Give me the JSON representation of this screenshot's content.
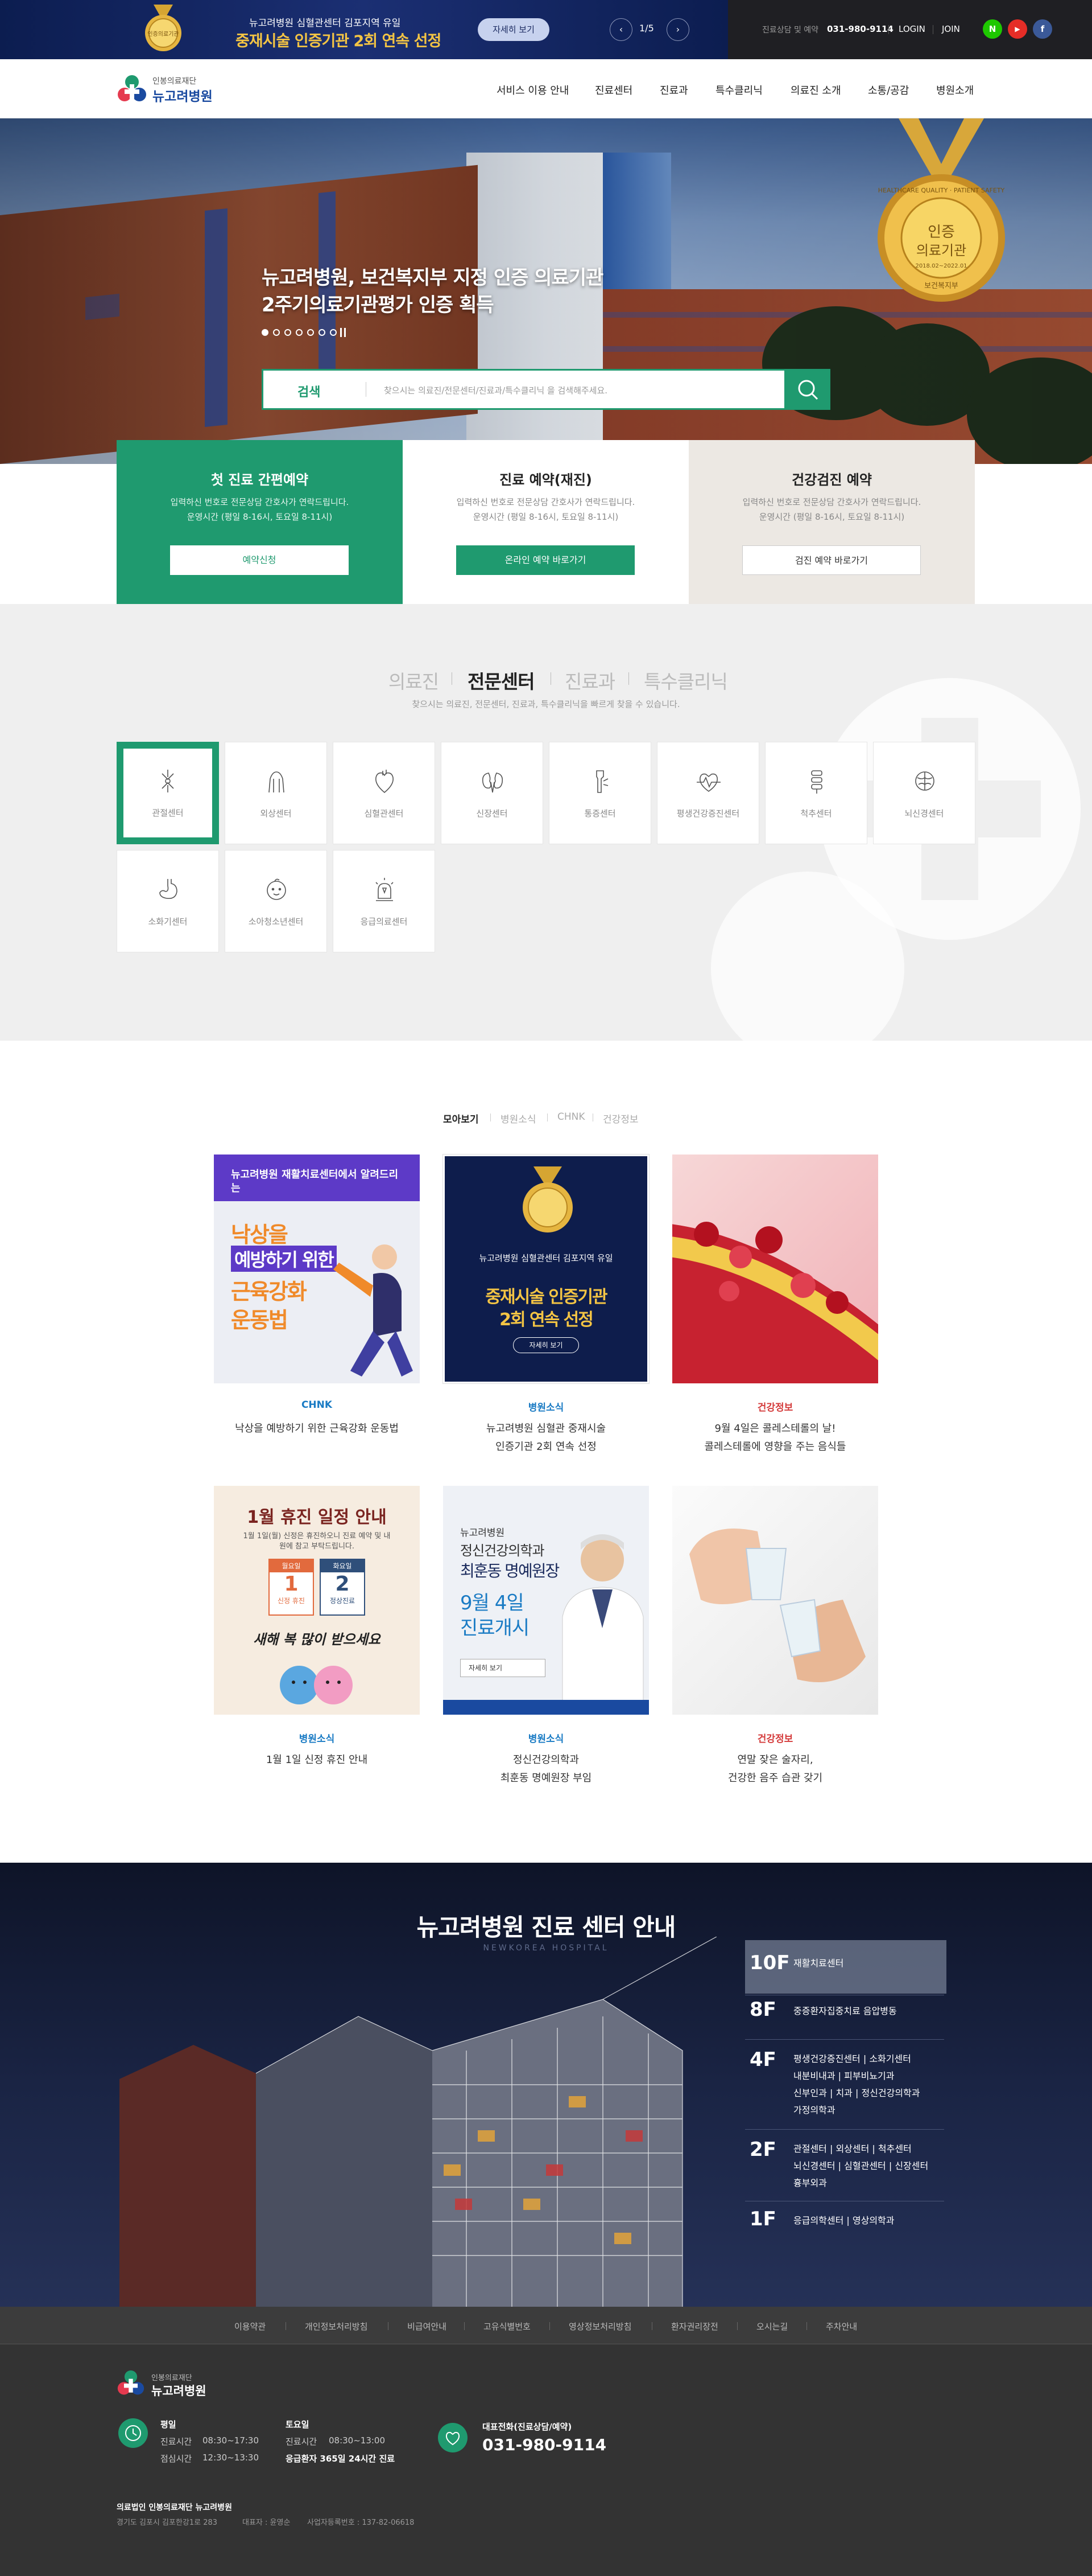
{
  "topbar": {
    "medal_text": "인증의료기관",
    "line1": "뉴고려병원 심혈관센터 김포지역 유일",
    "line2": "중재시술 인증기관 2회 연속 선정",
    "more": "자세히 보기",
    "prev": "‹",
    "next": "›",
    "page": "1/5",
    "phone_label": "진료상담 및 예약",
    "phone": "031-980-9114",
    "login": "LOGIN",
    "join": "JOIN",
    "sns": [
      {
        "name": "naver-icon",
        "label": "N",
        "color": "#1ec800"
      },
      {
        "name": "youtube-icon",
        "label": "▶",
        "color": "#e52d27"
      },
      {
        "name": "facebook-icon",
        "label": "f",
        "color": "#3b5998"
      }
    ]
  },
  "header": {
    "logo_sub": "인봉의료재단",
    "logo_main": "뉴고려병원",
    "nav": [
      "서비스 이용 안내",
      "진료센터",
      "진료과",
      "특수클리닉",
      "의료진 소개",
      "소통/공감",
      "병원소개"
    ]
  },
  "hero": {
    "title1": "뉴고려병원, 보건복지부 지정 인증 의료기관",
    "title2": "2주기의료기관평가 인증 획득",
    "badge_main": "인증",
    "badge_sub": "의료기관",
    "badge_ring": "HEALTHCARE QUALITY · PATIENT SAFETY",
    "badge_date": "2018.02~2022.01",
    "badge_org": "보건복지부",
    "search_label": "검색",
    "search_placeholder": "찾으시는 의료진/전문센터/진료과/특수클리닉 을 검색해주세요."
  },
  "reservations": [
    {
      "title": "첫 진료 간편예약",
      "desc1": "입력하신 번호로 전문상담 간호사가 연락드립니다.",
      "desc2": "운영시간 (평일 8-16시, 토요일 8-11시)",
      "button": "예약신청"
    },
    {
      "title": "진료 예약(재진)",
      "desc1": "입력하신 번호로 전문상담 간호사가 연락드립니다.",
      "desc2": "운영시간 (평일 8-16시, 토요일 8-11시)",
      "button": "온라인 예약 바로가기"
    },
    {
      "title": "건강검진 예약",
      "desc1": "입력하신 번호로 전문상담 간호사가 연락드립니다.",
      "desc2": "운영시간 (평일 8-16시, 토요일 8-11시)",
      "button": "검진 예약 바로가기"
    }
  ],
  "centers": {
    "tabs": [
      "의료진",
      "전문센터",
      "진료과",
      "특수클리닉"
    ],
    "subtitle": "찾으시는 의료진, 전문센터, 진료과, 특수클리닉을 빠르게 찾을 수 있습니다.",
    "items": [
      {
        "label": "관절센터",
        "icon": "joint-icon"
      },
      {
        "label": "외상센터",
        "icon": "trauma-icon"
      },
      {
        "label": "심혈관센터",
        "icon": "heart-icon"
      },
      {
        "label": "신장센터",
        "icon": "kidney-icon"
      },
      {
        "label": "통증센터",
        "icon": "pain-icon"
      },
      {
        "label": "평생건강증진센터",
        "icon": "heartbeat-icon"
      },
      {
        "label": "척추센터",
        "icon": "spine-icon"
      },
      {
        "label": "뇌신경센터",
        "icon": "brain-icon"
      },
      {
        "label": "소화기센터",
        "icon": "stomach-icon"
      },
      {
        "label": "소아청소년센터",
        "icon": "baby-icon"
      },
      {
        "label": "응급의료센터",
        "icon": "siren-icon"
      }
    ]
  },
  "news": {
    "tabs": [
      "모아보기",
      "병원소식",
      "CHNK",
      "건강정보"
    ],
    "cards": [
      {
        "category": "CHNK",
        "title1": "낙상을 예방하기 위한 근육강화 운동법",
        "title2": "",
        "img_head": "뉴고려병원 재활치료센터에서 알려드리는",
        "img_main1": "낙상을",
        "img_main2": "예방하기 위한",
        "img_main3": "근육강화",
        "img_main4": "운동법"
      },
      {
        "category": "병원소식",
        "title1": "뉴고려병원 심혈관 중재시술",
        "title2": "인증기관 2회 연속 선정",
        "img_head": "뉴고려병원 심혈관센터 김포지역 유일",
        "img_main1": "중재시술 인증기관",
        "img_main2": "2회 연속 선정",
        "img_btn": "자세히 보기"
      },
      {
        "category": "건강정보",
        "title1": "9월 4일은 콜레스테롤의 날!",
        "title2": "콜레스테롤에 영향을 주는 음식들"
      },
      {
        "category": "병원소식",
        "title1": "1월 1일 신정 휴진 안내",
        "title2": "",
        "img_main1": "1월 휴진 일정 안내",
        "img_head": "1월 1일(월) 신정은 휴진하오니 진료 예약 및 내원에 참고 부탁드립니다.",
        "img_d1_head": "월요일",
        "img_d1": "1",
        "img_d1_foot": "신정 휴진",
        "img_d2_head": "화요일",
        "img_d2": "2",
        "img_d2_foot": "정상진료",
        "img_main2": "새해 복 많이 받으세요"
      },
      {
        "category": "병원소식",
        "title1": "정신건강의학과",
        "title2": "최훈동 명예원장 부임",
        "img_head": "뉴고려병원",
        "img_main1": "정신건강의학과",
        "img_main2": "최훈동 명예원장",
        "img_main3": "9월 4일",
        "img_main4": "진료개시",
        "img_btn": "자세히 보기"
      },
      {
        "category": "건강정보",
        "title1": "연말 잦은 술자리,",
        "title2": "건강한 음주 습관 갖기"
      }
    ]
  },
  "floors": {
    "title": "뉴고려병원 진료 센터 안내",
    "subtitle": "NEWKOREA HOSPITAL",
    "items": [
      {
        "floor": "10F",
        "lines": [
          "재활치료센터"
        ]
      },
      {
        "floor": "8F",
        "lines": [
          "중증환자집중치료 음압병동"
        ]
      },
      {
        "floor": "4F",
        "lines": [
          "평생건강증진센터 | 소화기센터",
          "내분비내과 | 피부비뇨기과",
          "신부인과 | 치과 | 정신건강의학과",
          "가정의학과"
        ]
      },
      {
        "floor": "2F",
        "lines": [
          "관절센터 | 외상센터 | 척추센터",
          "뇌신경센터 | 심혈관센터 | 신장센터",
          "흉부외과"
        ]
      },
      {
        "floor": "1F",
        "lines": [
          "응급의학센터 | 영상의학과"
        ]
      }
    ]
  },
  "footer": {
    "links": [
      "이용약관",
      "개인정보처리방침",
      "비급여안내",
      "고유식별번호",
      "영상정보처리방침",
      "환자권리장전",
      "오시는길",
      "주차안내"
    ],
    "logo_sub": "인봉의료재단",
    "logo_main": "뉴고려병원",
    "weekday_label": "평일",
    "weekday_hours_label": "진료시간",
    "weekday_hours": "08:30~17:30",
    "lunch_label": "점심시간",
    "lunch_hours": "12:30~13:30",
    "sat_label": "토요일",
    "sat_hours_label": "진료시간",
    "sat_hours": "08:30~13:00",
    "emergency": "응급환자 365일 24시간 진료",
    "phone_label": "대표전화(진료상담/예약)",
    "phone": "031-980-9114",
    "corp": "의료법인 인봉의료재단 뉴고려병원",
    "address": "경기도 김포시 김포한강1로 283",
    "ceo": "대표자 : 윤영순",
    "bizno": "사업자등록번호 : 137-82-06618"
  },
  "colors": {
    "green": "#1f9a6f",
    "navy": "#0d1c4a",
    "gold": "#f3c444",
    "news_blue": "#1a7bc4",
    "health_red": "#d43a3a"
  }
}
